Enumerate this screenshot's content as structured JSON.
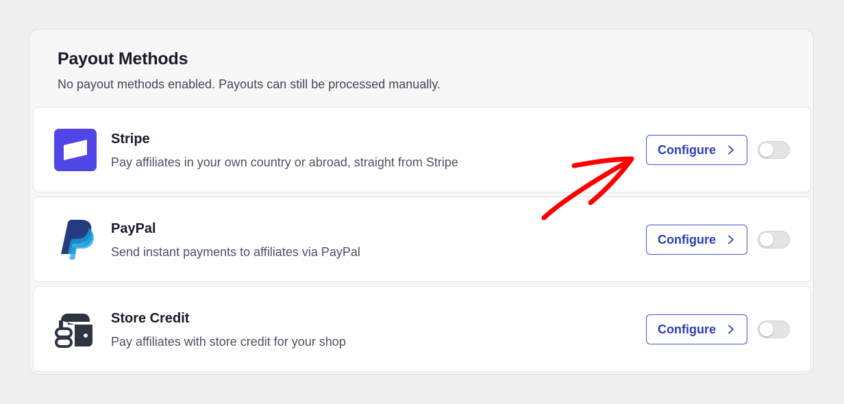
{
  "panel": {
    "title": "Payout Methods",
    "subtitle": "No payout methods enabled. Payouts can still be processed manually."
  },
  "methods": [
    {
      "name": "Stripe",
      "description": "Pay affiliates in your own country or abroad, straight from Stripe",
      "button_label": "Configure",
      "enabled": false,
      "icon": "stripe-icon"
    },
    {
      "name": "PayPal",
      "description": "Send instant payments to affiliates via PayPal",
      "button_label": "Configure",
      "enabled": false,
      "icon": "paypal-icon"
    },
    {
      "name": "Store Credit",
      "description": "Pay affiliates with store credit for your shop",
      "button_label": "Configure",
      "enabled": false,
      "icon": "wallet-icon"
    }
  ],
  "colors": {
    "accent": "#2a3fb0",
    "stripe": "#5046e5",
    "paypal_dark": "#253b80",
    "paypal_light": "#179bd7",
    "annotation": "#ff0000"
  }
}
